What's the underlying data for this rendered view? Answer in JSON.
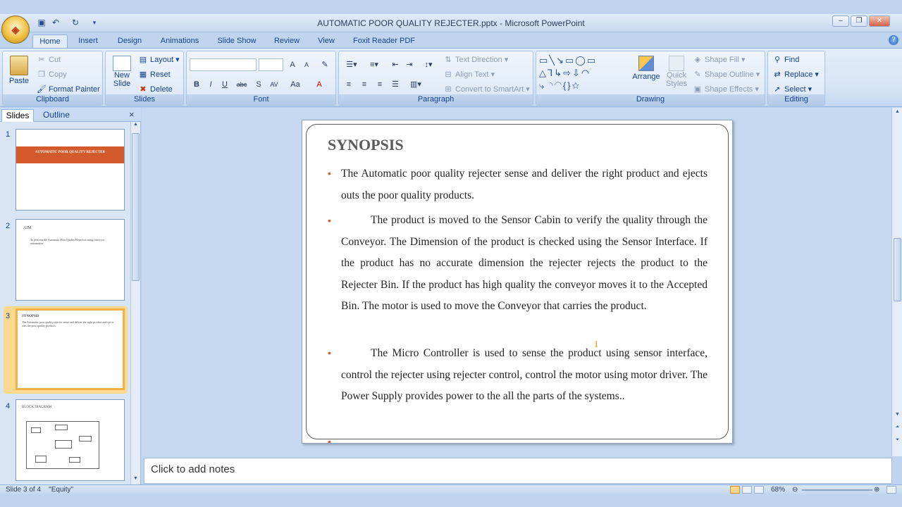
{
  "window": {
    "title": "AUTOMATIC POOR QUALITY REJECTER.pptx - Microsoft PowerPoint"
  },
  "qat": {
    "save_icon": "save-icon",
    "undo_icon": "undo-icon",
    "redo_icon": "redo-icon"
  },
  "tabs": [
    "Home",
    "Insert",
    "Design",
    "Animations",
    "Slide Show",
    "Review",
    "View",
    "Foxit Reader PDF"
  ],
  "ribbon": {
    "clipboard": {
      "paste": "Paste",
      "cut": "Cut",
      "copy": "Copy",
      "format_painter": "Format Painter",
      "label": "Clipboard"
    },
    "slides": {
      "new_slide_line1": "New",
      "new_slide_line2": "Slide",
      "layout": "Layout",
      "reset": "Reset",
      "delete": "Delete",
      "label": "Slides"
    },
    "font": {
      "label": "Font",
      "bold": "B",
      "italic": "I",
      "underline": "U",
      "strike": "abc",
      "shadow": "S",
      "grow": "A",
      "shrink": "A",
      "case": "Aa",
      "color": "A"
    },
    "paragraph": {
      "text_direction": "Text Direction",
      "align_text": "Align Text",
      "convert_smartart": "Convert to SmartArt",
      "label": "Paragraph"
    },
    "drawing": {
      "arrange": "Arrange",
      "quick_styles_line1": "Quick",
      "quick_styles_line2": "Styles",
      "shape_fill": "Shape Fill",
      "shape_outline": "Shape Outline",
      "shape_effects": "Shape Effects",
      "label": "Drawing"
    },
    "editing": {
      "find": "Find",
      "replace": "Replace",
      "select": "Select",
      "label": "Editing"
    }
  },
  "panel": {
    "tab_slides": "Slides",
    "tab_outline": "Outline",
    "close": "×"
  },
  "thumbnails": [
    {
      "num": "1",
      "title": "AUTOMATIC POOR QUALITY REJECTER"
    },
    {
      "num": "2",
      "title": "AIM",
      "bullet": "To perform the Automatic Poor Quality Rejection using conveyor automation."
    },
    {
      "num": "3",
      "title": "SYNOPSIS"
    },
    {
      "num": "4",
      "title": "BLOCK DIAGRAM"
    }
  ],
  "slide": {
    "title": "SYNOPSIS",
    "bullets": [
      "The Automatic poor quality rejecter sense and deliver the right product and ejects outs the poor quality products.",
      "The product is moved to the Sensor Cabin to verify the quality through the Conveyor. The Dimension of the product is checked using the Sensor Interface. If the product has no accurate dimension the rejecter rejects the product to the Rejecter Bin. If the product has high quality the conveyor moves it to the Accepted Bin. The motor is used to move the Conveyor that carries the product.",
      "The Micro Controller is used to sense the product using sensor interface, control the rejecter using rejecter control, control the motor using motor driver. The Power Supply provides power to the all the parts of the systems.."
    ]
  },
  "notes": {
    "placeholder": "Click to add notes"
  },
  "status": {
    "slide_info": "Slide 3 of 4",
    "theme": "\"Equity\"",
    "zoom": "68%"
  },
  "colors": {
    "accent": "#d35a2a",
    "ribbon": "#dbe7f6",
    "selected_thumb": "#f5b04a"
  }
}
